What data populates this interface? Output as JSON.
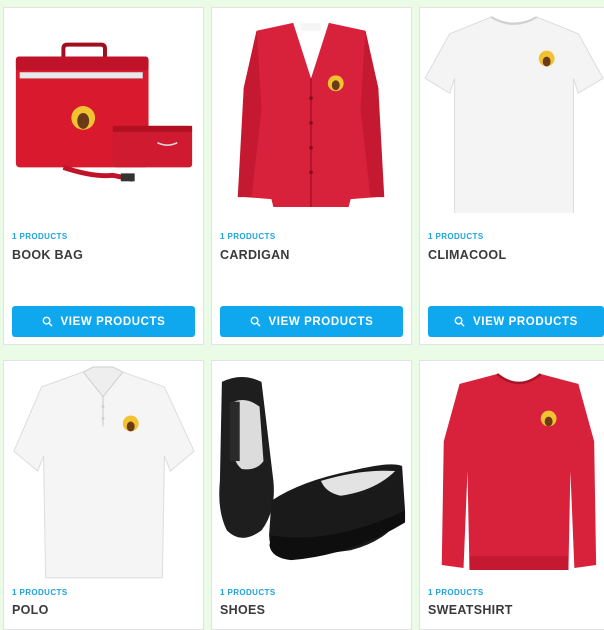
{
  "products": [
    {
      "id": "book-bag",
      "count": "1 PRODUCTS",
      "name": "BOOK BAG",
      "button": "VIEW PRODUCTS",
      "icon": "book-bag-image"
    },
    {
      "id": "cardigan",
      "count": "1 PRODUCTS",
      "name": "CARDIGAN",
      "button": "VIEW PRODUCTS",
      "icon": "cardigan-image"
    },
    {
      "id": "climacool",
      "count": "1 PRODUCTS",
      "name": "CLIMACOOL",
      "button": "VIEW PRODUCTS",
      "icon": "climacool-tshirt-image"
    },
    {
      "id": "polo",
      "count": "1 PRODUCTS",
      "name": "POLO",
      "icon": "polo-shirt-image"
    },
    {
      "id": "shoes",
      "count": "1 PRODUCTS",
      "name": "SHOES",
      "icon": "shoes-image"
    },
    {
      "id": "sweatshirt",
      "count": "1 PRODUCTS",
      "name": "SWEATSHIRT",
      "icon": "sweatshirt-image"
    }
  ],
  "colors": {
    "accent": "#0fa8ef",
    "count_text": "#1aa3e0",
    "title_text": "#3a3a3a",
    "garment_red": "#d8213a",
    "page_bg": "#eafbe6"
  }
}
